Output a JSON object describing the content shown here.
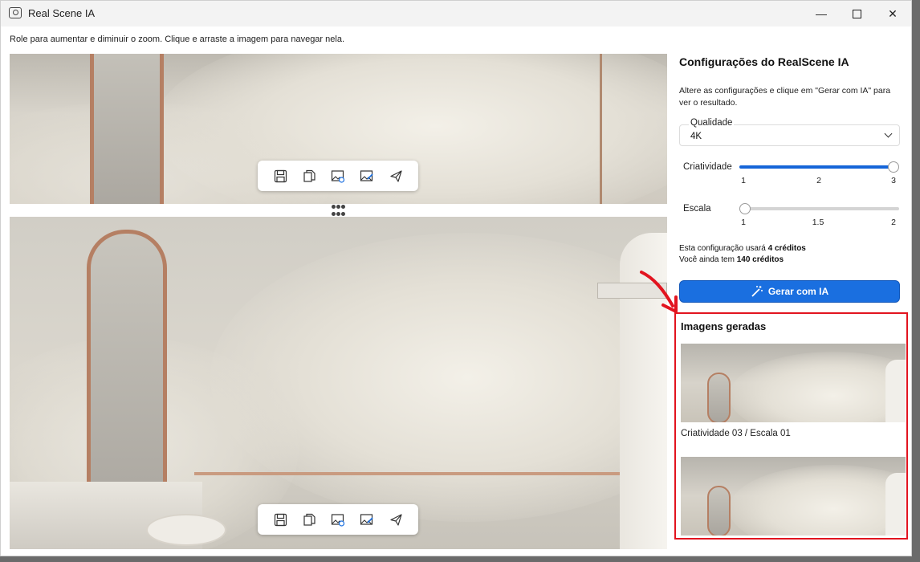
{
  "window": {
    "title": "Real Scene IA",
    "minimize_glyph": "—",
    "maximize_glyph": "☐",
    "close_glyph": "✕"
  },
  "hint": "Role para aumentar e diminuir o zoom. Clique e arraste a imagem para navegar nela.",
  "toolbar_icons": [
    "save-icon",
    "copy-icon",
    "image-export-icon",
    "image-edit-icon",
    "send-icon"
  ],
  "settings": {
    "title": "Configurações do RealScene IA",
    "description": "Altere as configurações e clique em \"Gerar com IA\" para ver o resultado.",
    "quality_label": "Qualidade",
    "quality_value": "4K",
    "creativity_label": "Criatividade",
    "creativity_ticks": [
      "1",
      "2",
      "3"
    ],
    "creativity_value": 3,
    "scale_label": "Escala",
    "scale_ticks": [
      "1",
      "1.5",
      "2"
    ],
    "scale_value": 1,
    "credits_line1_prefix": "Esta configuração usará ",
    "credits_line1_bold": "4 créditos",
    "credits_line2_prefix": "Você ainda tem ",
    "credits_line2_bold": "140 créditos",
    "generate_label": "Gerar com IA"
  },
  "gallery": {
    "title": "Imagens geradas",
    "items": [
      {
        "caption": "Criatividade 03 / Escala 01"
      },
      {
        "caption": ""
      }
    ]
  },
  "colors": {
    "accent": "#1a6fe0",
    "highlight_box": "#e2141f"
  }
}
